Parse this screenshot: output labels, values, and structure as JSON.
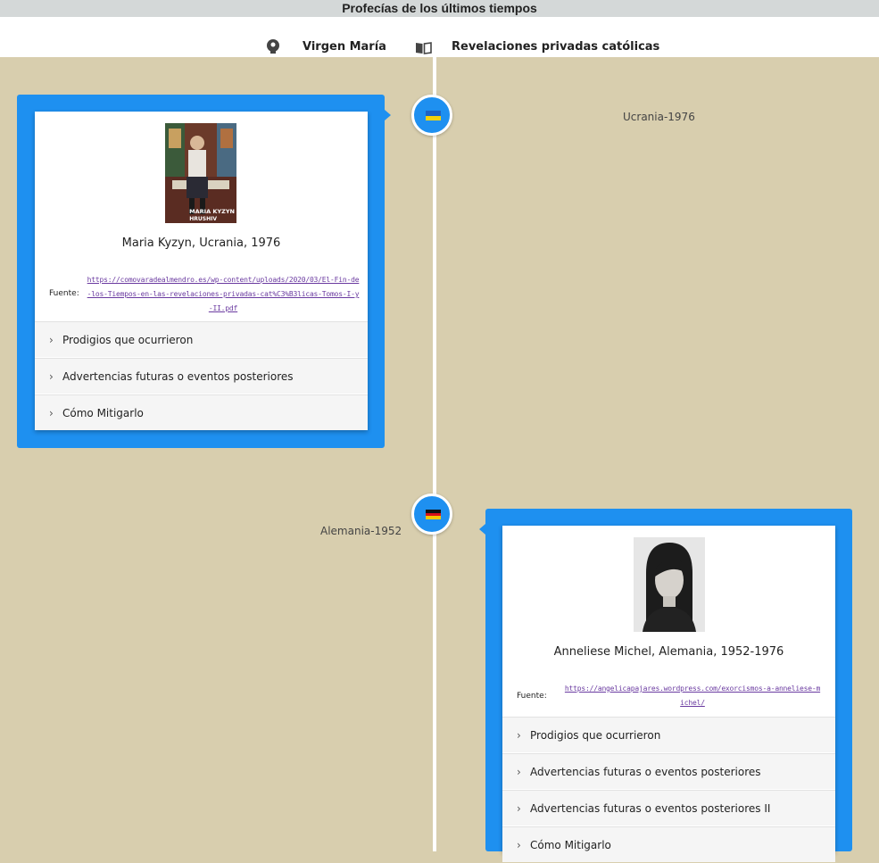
{
  "page": {
    "title": "Profecías de los últimos tiempos"
  },
  "header": {
    "items": [
      {
        "label": "Virgen María",
        "icon": "lightbulb-icon"
      },
      {
        "label": "Revelaciones privadas católicas",
        "icon": "book-icon"
      }
    ]
  },
  "colors": {
    "accent": "#1e90f0",
    "background": "#d8ceae",
    "link": "#6a3aa0"
  },
  "events": [
    {
      "date_label": "Ucrania-1976",
      "flag": "ukraine",
      "flag_colors": [
        "#1d63c4",
        "#f5d20a"
      ],
      "title": "Maria Kyzyn, Ucrania, 1976",
      "photo_caption": "MARIA KYZYN\nHRUSHIV",
      "source_label": "Fuente:",
      "source_url": "https://comovaradealmendro.es/wp-content/uploads/2020/03/El-Fin-de-los-Tiempos-en-las-revelaciones-privadas-cat%C3%B3licas-Tomos-I-y-II.pdf",
      "sections": [
        "Prodigios que ocurrieron",
        "Advertencias futuras o eventos posteriores",
        "Cómo Mitigarlo"
      ]
    },
    {
      "date_label": "Alemania-1952",
      "flag": "germany",
      "flag_colors": [
        "#111111",
        "#d8101a",
        "#f7c600"
      ],
      "title": "Anneliese Michel, Alemania, 1952-1976",
      "source_label": "Fuente:",
      "source_url": "https://angelicapajares.wordpress.com/exorcismos-a-anneliese-michel/",
      "sections": [
        "Prodigios que ocurrieron",
        "Advertencias futuras o eventos posteriores",
        "Advertencias futuras o eventos posteriores II",
        "Cómo Mitigarlo"
      ]
    }
  ]
}
